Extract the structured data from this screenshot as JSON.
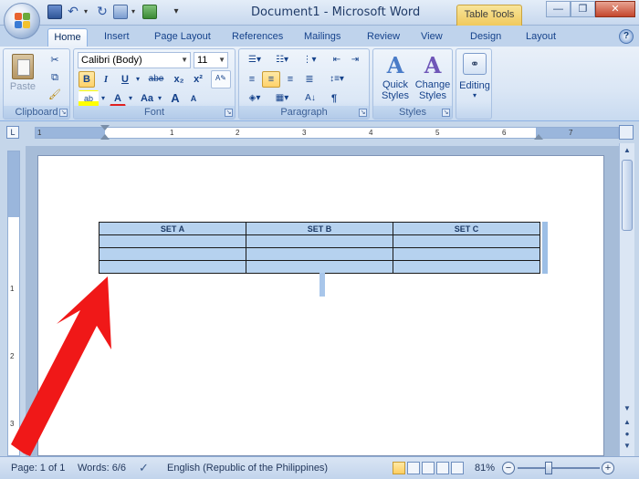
{
  "titlebar": {
    "title": "Document1 - Microsoft Word",
    "context_tab": "Table Tools",
    "min": "—",
    "max": "❐",
    "close": "✕"
  },
  "tabs": [
    "Home",
    "Insert",
    "Page Layout",
    "References",
    "Mailings",
    "Review",
    "View",
    "Design",
    "Layout"
  ],
  "ribbon": {
    "clipboard": {
      "paste": "Paste",
      "label": "Clipboard"
    },
    "font": {
      "name": "Calibri (Body)",
      "size": "11",
      "bold": "B",
      "italic": "I",
      "underline": "U",
      "strike": "abe",
      "sub": "x₂",
      "sup": "x²",
      "case": "Aa",
      "grow": "A",
      "shrink": "A",
      "label": "Font"
    },
    "paragraph": {
      "label": "Paragraph",
      "pilcrow": "¶"
    },
    "styles": {
      "quick": "Quick",
      "quick2": "Styles",
      "change": "Change",
      "change2": "Styles",
      "label": "Styles"
    },
    "editing": {
      "label": "Editing"
    }
  },
  "ruler": {
    "numbers": [
      "1",
      "1",
      "2",
      "3",
      "4",
      "5",
      "6",
      "7"
    ],
    "vnumbers": [
      "1",
      "2",
      "3"
    ]
  },
  "document": {
    "table_headers": [
      "SET A",
      "SET B",
      "SET C"
    ],
    "empty_rows": 3
  },
  "statusbar": {
    "page": "Page: 1 of 1",
    "words": "Words: 6/6",
    "language": "English (Republic of the Philippines)",
    "zoom": "81%",
    "zoom_minus": "−",
    "zoom_plus": "+"
  },
  "colors": {
    "accent": "#15428b",
    "annotation_arrow": "#f01818",
    "table_fill": "#b6d2ef"
  }
}
